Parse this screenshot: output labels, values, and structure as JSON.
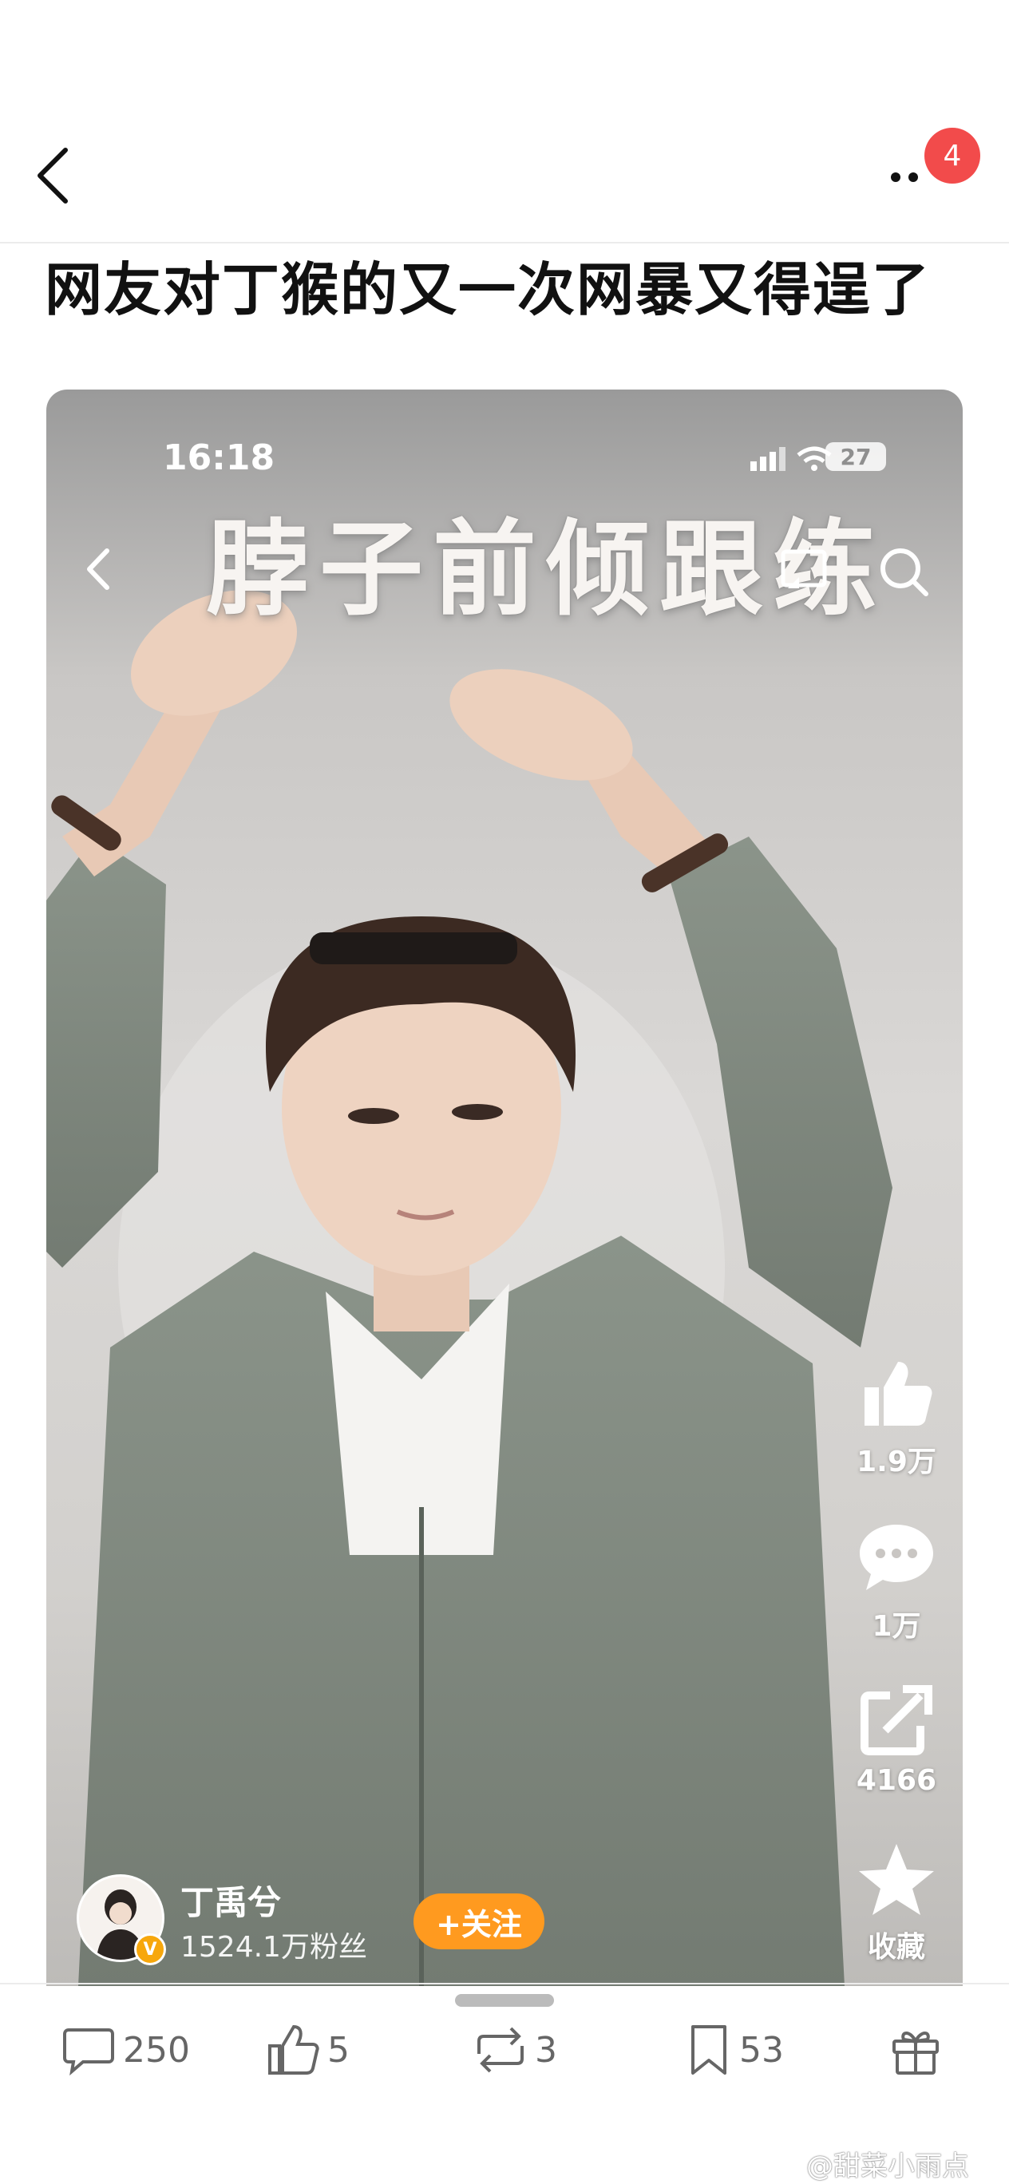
{
  "nav": {
    "notification_count": "4"
  },
  "post": {
    "title": "网友对丁猴的又一次网暴又得逞了"
  },
  "video": {
    "status_time": "16:18",
    "battery": "27",
    "caption": "脖子前倾跟练",
    "actions": {
      "like_count": "1.9万",
      "comment_count": "1万",
      "share_count": "4166",
      "favorite_label": "收藏"
    },
    "author": {
      "name": "丁禹兮",
      "fans": "1524.1万粉丝",
      "verify_mark": "V",
      "follow_label": "+关注"
    }
  },
  "bottom_bar": {
    "comments": "250",
    "likes": "5",
    "reposts": "3",
    "favorites": "53"
  },
  "watermark": "@甜菜小雨点",
  "colors": {
    "badge": "#f24b4b",
    "follow_button": "#ff9a1f",
    "verify": "#f7a70c"
  }
}
